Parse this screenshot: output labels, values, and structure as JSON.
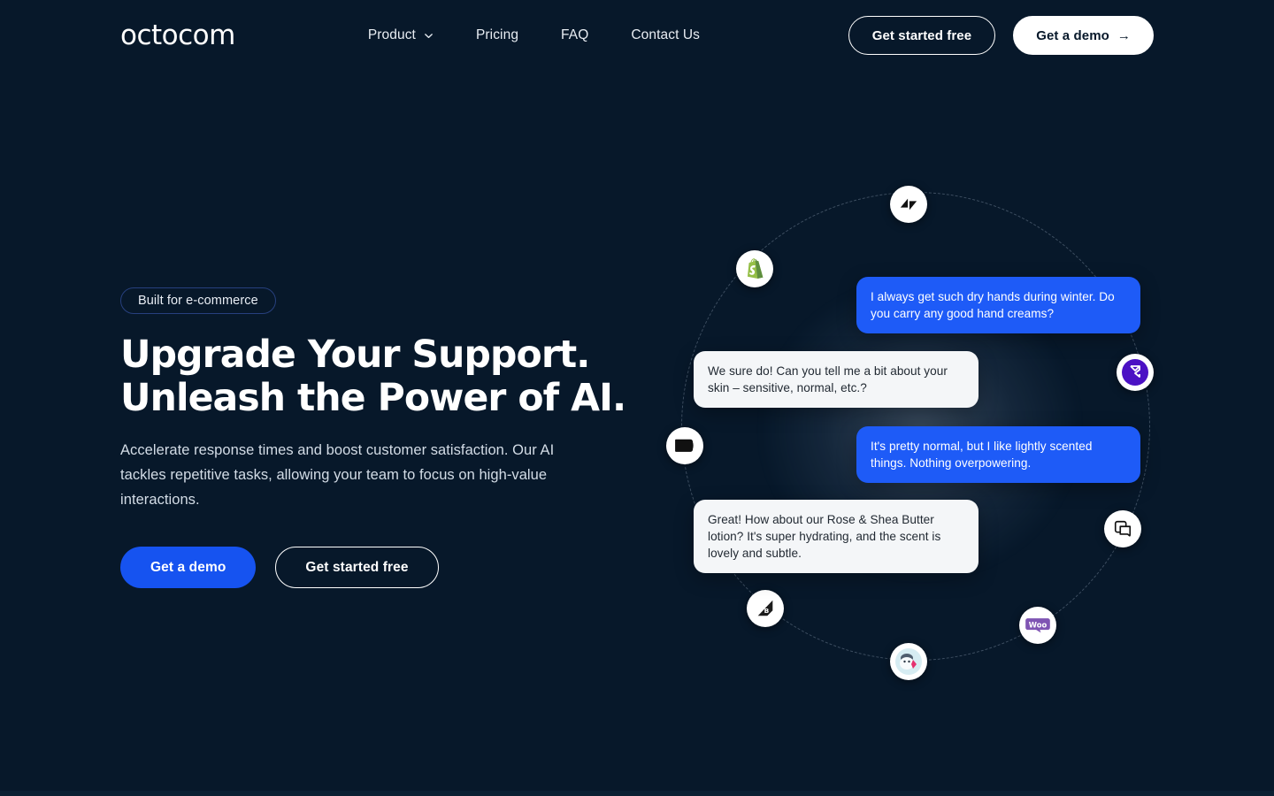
{
  "brand": {
    "logo_text": "octocom",
    "accent_blue": "#1653f0",
    "bg_dark": "#07182a",
    "badge_border": "#27407e"
  },
  "header": {
    "nav": [
      {
        "label": "Product",
        "has_dropdown": true,
        "icon": "chevron-down-icon"
      },
      {
        "label": "Pricing",
        "has_dropdown": false
      },
      {
        "label": "FAQ",
        "has_dropdown": false
      },
      {
        "label": "Contact Us",
        "has_dropdown": false
      }
    ],
    "actions": {
      "secondary_label": "Get started free",
      "primary_label": "Get a demo",
      "primary_icon": "arrow-right-icon",
      "primary_arrow": "→"
    }
  },
  "hero": {
    "badge": "Built for e-commerce",
    "title_line1": "Upgrade Your Support.",
    "title_line2": "Unleash the Power of AI.",
    "subtitle": "Accelerate response times and boost customer satisfaction. Our AI tackles repetitive tasks, allowing your team to focus on high-value interactions.",
    "cta_primary": "Get a demo",
    "cta_secondary": "Get started free"
  },
  "chat": {
    "messages": [
      {
        "role": "user",
        "text": "I always get such dry hands during winter. Do you carry any good hand creams?"
      },
      {
        "role": "bot",
        "text": "We sure do! Can you tell me a bit about your skin – sensitive, normal, etc.?"
      },
      {
        "role": "user",
        "text": "It's pretty normal, but I like lightly scented things. Nothing overpowering."
      },
      {
        "role": "bot",
        "text": "Great! How about our Rose & Shea Butter lotion? It's super hydrating, and the scent is lovely and subtle."
      }
    ]
  },
  "integrations": [
    {
      "name": "Zendesk",
      "icon": "zendesk-icon"
    },
    {
      "name": "Shopify",
      "icon": "shopify-icon"
    },
    {
      "name": "Gorgias",
      "icon": "gorgias-icon"
    },
    {
      "name": "Klaviyo",
      "icon": "klaviyo-icon"
    },
    {
      "name": "Intercom",
      "icon": "intercom-icon"
    },
    {
      "name": "WooCommerce",
      "icon": "woocommerce-icon"
    },
    {
      "name": "PrestaShop",
      "icon": "prestashop-icon"
    },
    {
      "name": "BigCommerce",
      "icon": "bigcommerce-icon"
    }
  ]
}
